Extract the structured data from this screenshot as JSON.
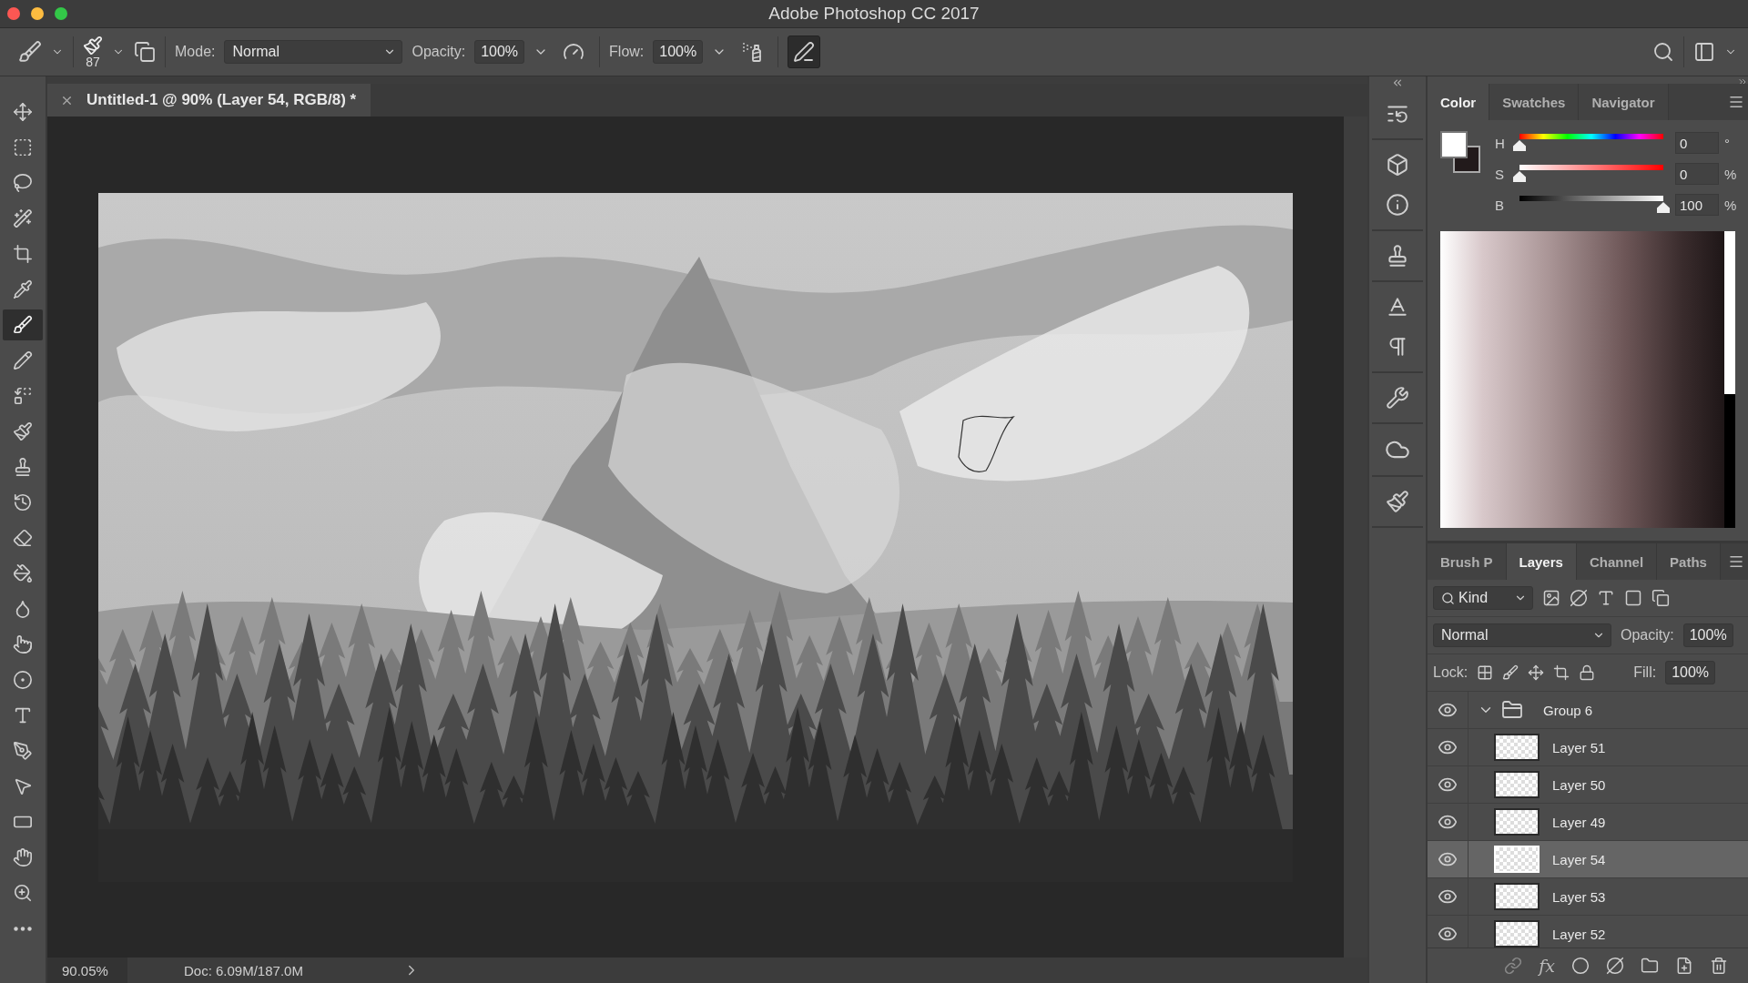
{
  "window": {
    "title": "Adobe Photoshop CC 2017"
  },
  "options_bar": {
    "brush_size": "87",
    "mode_label": "Mode:",
    "mode": "Normal",
    "opacity_label": "Opacity:",
    "opacity": "100%",
    "pressure_opacity_on": false,
    "flow_label": "Flow:",
    "flow": "100%",
    "airbrush_on": false,
    "pressure_size_on": true
  },
  "document_tab": {
    "title": "Untitled-1 @ 90% (Layer 54, RGB/8) *"
  },
  "tools": [
    {
      "kind": "move",
      "selected": false
    },
    {
      "kind": "marquee",
      "selected": false
    },
    {
      "kind": "lasso",
      "selected": false
    },
    {
      "kind": "quick_select",
      "selected": false
    },
    {
      "kind": "crop",
      "selected": false
    },
    {
      "kind": "eyedropper",
      "selected": false
    },
    {
      "kind": "brush",
      "selected": true
    },
    {
      "kind": "pencil",
      "selected": false
    },
    {
      "kind": "color_replace",
      "selected": false
    },
    {
      "kind": "mixer_brush",
      "selected": false
    },
    {
      "kind": "stamp",
      "selected": false
    },
    {
      "kind": "history_brush",
      "selected": false
    },
    {
      "kind": "eraser",
      "selected": false
    },
    {
      "kind": "bucket",
      "selected": false
    },
    {
      "kind": "blur",
      "selected": false
    },
    {
      "kind": "smudge",
      "selected": false
    },
    {
      "kind": "sponge",
      "selected": false
    },
    {
      "kind": "type",
      "selected": false
    },
    {
      "kind": "pen",
      "selected": false
    },
    {
      "kind": "path_select",
      "selected": false
    },
    {
      "kind": "rectangle",
      "selected": false
    },
    {
      "kind": "hand",
      "selected": false
    },
    {
      "kind": "zoom",
      "selected": false
    },
    {
      "kind": "more",
      "selected": false
    }
  ],
  "status_bar": {
    "zoom": "90.05%",
    "doc": "Doc: 6.09M/187.0M"
  },
  "color_panel": {
    "tabs": [
      {
        "label": "Color",
        "selected": true
      },
      {
        "label": "Swatches",
        "selected": false
      },
      {
        "label": "Navigator",
        "selected": false
      }
    ],
    "sliders": [
      {
        "kind": "hue",
        "label": "H",
        "level": 0,
        "value": "0",
        "unit": "°"
      },
      {
        "kind": "saturation",
        "label": "S",
        "level": 0,
        "value": "0",
        "unit": "%"
      },
      {
        "kind": "brightness",
        "label": "B",
        "level": 1,
        "value": "100",
        "unit": "%"
      }
    ]
  },
  "layers_panel": {
    "tabs": [
      {
        "label": "Brush P",
        "selected": false
      },
      {
        "label": "Layers",
        "selected": true
      },
      {
        "label": "Channel",
        "selected": false
      },
      {
        "label": "Paths",
        "selected": false
      }
    ],
    "filter": "Kind",
    "blend_mode": "Normal",
    "opacity_label": "Opacity:",
    "opacity": "100%",
    "lock_label": "Lock:",
    "fill_label": "Fill:",
    "fill": "100%",
    "effects_label": "fx",
    "layers": [
      {
        "name": "Group 6",
        "kind": "group",
        "visible": true,
        "expanded": true,
        "selected": false,
        "children": [
          {
            "name": "Layer 51",
            "kind": "layer",
            "visible": true,
            "selected": false
          },
          {
            "name": "Layer 50",
            "kind": "layer",
            "visible": true,
            "selected": false
          },
          {
            "name": "Layer 49",
            "kind": "layer",
            "visible": true,
            "selected": false
          },
          {
            "name": "Layer 54",
            "kind": "layer",
            "visible": true,
            "selected": true
          },
          {
            "name": "Layer 53",
            "kind": "layer",
            "visible": true,
            "selected": false
          },
          {
            "name": "Layer 52",
            "kind": "layer",
            "visible": true,
            "selected": false
          }
        ]
      }
    ]
  }
}
